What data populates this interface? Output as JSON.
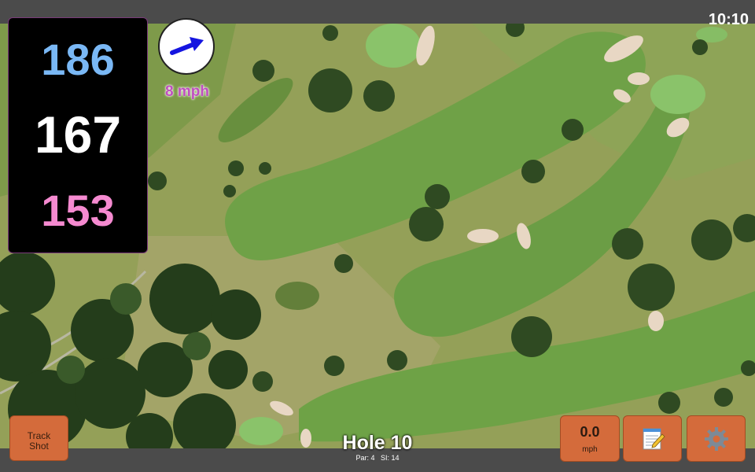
{
  "clock": "10:10",
  "distances": {
    "back": "186",
    "middle": "167",
    "front": "153"
  },
  "wind": {
    "speed": "8 mph",
    "icon": "wind-arrow-icon"
  },
  "buttons": {
    "track_line1": "Track",
    "track_line2": "Shot",
    "speed_value": "0.0",
    "speed_unit": "mph",
    "notes_icon": "notepad-icon",
    "settings_icon": "gear-icon"
  },
  "hole": {
    "title": "Hole 10",
    "par": "Par: 4",
    "si": "SI: 14"
  },
  "colors": {
    "back": "#7ab8f5",
    "middle": "#ffffff",
    "front": "#f58ad0",
    "button": "#d46b3b",
    "wind_text": "#c04ec0"
  }
}
